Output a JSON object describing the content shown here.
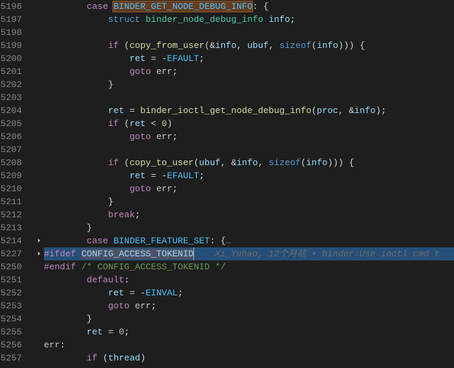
{
  "gutter": [
    "5196",
    "5197",
    "5198",
    "5199",
    "5200",
    "5201",
    "5202",
    "5203",
    "5204",
    "5205",
    "5206",
    "5207",
    "5208",
    "5209",
    "5210",
    "5211",
    "5212",
    "5213",
    "5214",
    "5227",
    "5250",
    "5251",
    "5252",
    "5253",
    "5254",
    "5255",
    "5256",
    "5257"
  ],
  "code": {
    "l5196": {
      "kw": "case",
      "enum": "BINDER_GET_NODE_DEBUG_INFO",
      "tail": ": {"
    },
    "l5197": {
      "kw": "struct",
      "type": "binder_node_debug_info",
      "var": "info",
      "tail": ";"
    },
    "l5199": {
      "kw": "if",
      "p1": " (",
      "fn": "copy_from_user",
      "args_open": "(&",
      "v1": "info",
      "c1": ", ",
      "v2": "ubuf",
      "c2": ", ",
      "fn2": "sizeof",
      "open2": "(",
      "v3": "info",
      "close": "))) {"
    },
    "l5200": {
      "v": "ret",
      "op": " = -",
      "enum": "EFAULT",
      "tail": ";"
    },
    "l5201": {
      "kw": "goto",
      "lbl": " err",
      "tail": ";"
    },
    "l5202": {
      "brace": "}"
    },
    "l5204": {
      "v": "ret",
      "op": " = ",
      "fn": "binder_ioctl_get_node_debug_info",
      "open": "(",
      "v1": "proc",
      "c1": ", &",
      "v2": "info",
      "close": ");"
    },
    "l5205": {
      "kw": "if",
      "open": " (",
      "v": "ret",
      "op": " < ",
      "num": "0",
      "close": ")"
    },
    "l5206": {
      "kw": "goto",
      "lbl": " err",
      "tail": ";"
    },
    "l5208": {
      "kw": "if",
      "p1": " (",
      "fn": "copy_to_user",
      "open": "(",
      "v1": "ubuf",
      "c1": ", &",
      "v2": "info",
      "c2": ", ",
      "fn2": "sizeof",
      "open2": "(",
      "v3": "info",
      "close": "))) {"
    },
    "l5209": {
      "v": "ret",
      "op": " = -",
      "enum": "EFAULT",
      "tail": ";"
    },
    "l5210": {
      "kw": "goto",
      "lbl": " err",
      "tail": ";"
    },
    "l5211": {
      "brace": "}"
    },
    "l5212": {
      "kw": "break",
      "tail": ";"
    },
    "l5213": {
      "brace": "}"
    },
    "l5214": {
      "kw": "case",
      "enum": "BINDER_FEATURE_SET",
      "tail": ": {",
      "dots": "…"
    },
    "l5227": {
      "macro": "#ifdef",
      "def": "CONFIG_ACCESS_TOKENID"
    },
    "l5250": {
      "macro": "#endif",
      "comment": "/* CONFIG_ACCESS_TOKENID */"
    },
    "l5251": {
      "kw": "default",
      "tail": ":"
    },
    "l5252": {
      "v": "ret",
      "op": " = -",
      "enum": "EINVAL",
      "tail": ";"
    },
    "l5253": {
      "kw": "goto",
      "lbl": " err",
      "tail": ";"
    },
    "l5254": {
      "brace": "}"
    },
    "l5255": {
      "v": "ret",
      "op": " = ",
      "num": "0",
      "tail": ";"
    },
    "l5256": {
      "lbl": "err",
      "tail": ":"
    },
    "l5257": {
      "kw": "if",
      "open": " (",
      "v": "thread",
      "close": ")"
    }
  },
  "blame": {
    "author": "Xi_Yuhao",
    "when": "12个月前",
    "msg": "binder:Use ioctl cmd t"
  }
}
